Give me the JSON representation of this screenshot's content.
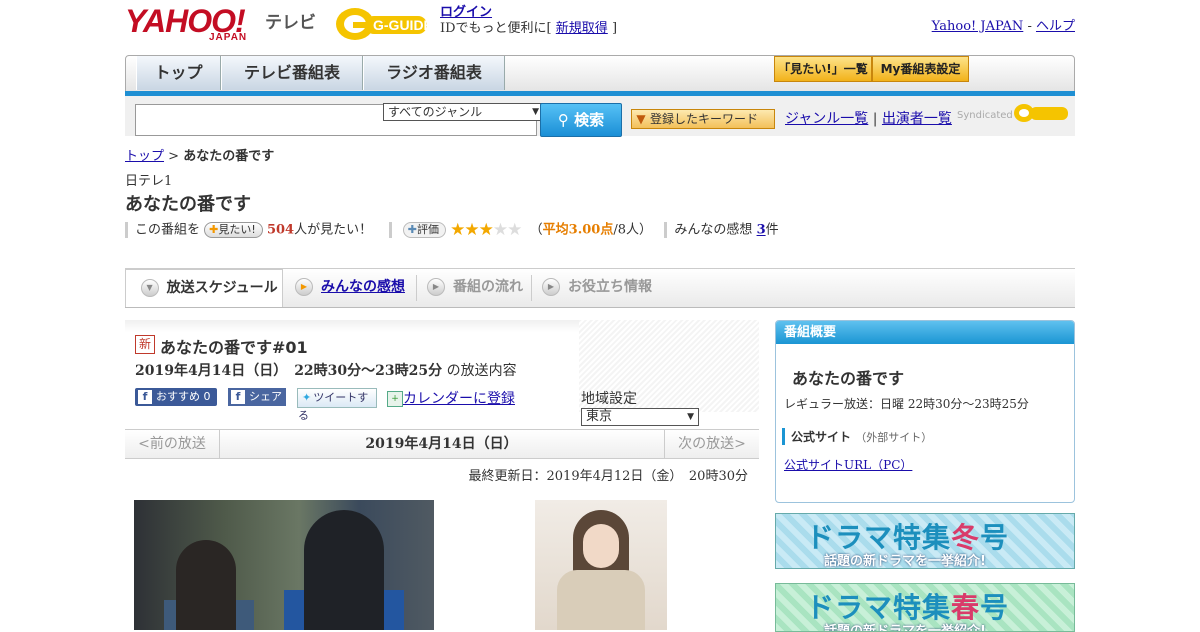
{
  "header": {
    "yahoo_logo": "YAHOO!",
    "yahoo_japan": "JAPAN",
    "tv_label": "テレビ",
    "gguide_logo": "G-GUIDE",
    "login_link": "ログイン",
    "login_prefix": "IDでもっと便利に[",
    "signup_link": "新規取得",
    "login_suffix": "]",
    "yahoo_japan_link": "Yahoo! JAPAN",
    "sep": "-",
    "help_link": "ヘルプ"
  },
  "nav": {
    "tabs": [
      "トップ",
      "テレビ番組表",
      "ラジオ番組表"
    ],
    "mitai_list": "「見たい!」一覧",
    "my_schedule": "My番組表設定"
  },
  "search": {
    "genre_selected": "すべてのジャンル",
    "search_button": "検索",
    "keyword_button": "登録したキーワード",
    "genre_list_link": "ジャンル一覧",
    "link_sep": "|",
    "cast_list_link": "出演者一覧",
    "syndicated": "Syndicated"
  },
  "breadcrumb": {
    "top": "トップ",
    "sep": ">",
    "current": "あなたの番です"
  },
  "program": {
    "station": "日テレ1",
    "title": "あなたの番です",
    "mitai_prefix": "この番組を",
    "mitai_button": "見たい!",
    "mitai_count": "504",
    "mitai_suffix": "人が見たい！",
    "rating_button": "評価",
    "rating_stars": 3,
    "rating_paren_open": "（",
    "rating_avg": "平均3.00点",
    "rating_count": "/8人",
    "rating_paren_close": "）",
    "impressions_label": "みんなの感想",
    "impressions_count": "3",
    "impressions_unit": "件"
  },
  "tabs": [
    {
      "label": "放送スケジュール"
    },
    {
      "label": "みんなの感想"
    },
    {
      "label": "番組の流れ"
    },
    {
      "label": "お役立ち情報"
    }
  ],
  "episode": {
    "new_badge": "新",
    "title": "あなたの番です#01",
    "date_time": "2019年4月14日（日）　22時30分～23時25分",
    "date_suffix": "の放送内容",
    "fb_recommend": "おすすめ",
    "fb_count": "0",
    "fb_share": "シェア",
    "tweet": "ツイートする",
    "calendar": "カレンダーに登録",
    "region_label": "地域設定",
    "region_value": "東京"
  },
  "date_nav": {
    "prev": "<前の放送",
    "current": "2019年4月14日（日）",
    "next": "次の放送>"
  },
  "updated": "最終更新日：2019年4月12日（金）　20時30分",
  "sidebar": {
    "header": "番組概要",
    "title": "あなたの番です",
    "regular": "レギュラー放送：日曜 22時30分～23時25分",
    "official_label": "公式サイト",
    "official_note": "（外部サイト）",
    "official_url": "公式サイトURL（PC）"
  },
  "banners": [
    {
      "main_pre": "ドラマ特集",
      "main_hl": "冬",
      "main_post": "号",
      "sub": "話題の新ドラマを一挙紹介!"
    },
    {
      "main_pre": "ドラマ特集",
      "main_hl": "春",
      "main_post": "号",
      "sub": "話題の新ドラマを一挙紹介!"
    }
  ],
  "colors": {
    "accent_blue": "#1b95d3",
    "link": "#1a0dab",
    "brand_red": "#c30d23",
    "star": "#f3a800"
  }
}
